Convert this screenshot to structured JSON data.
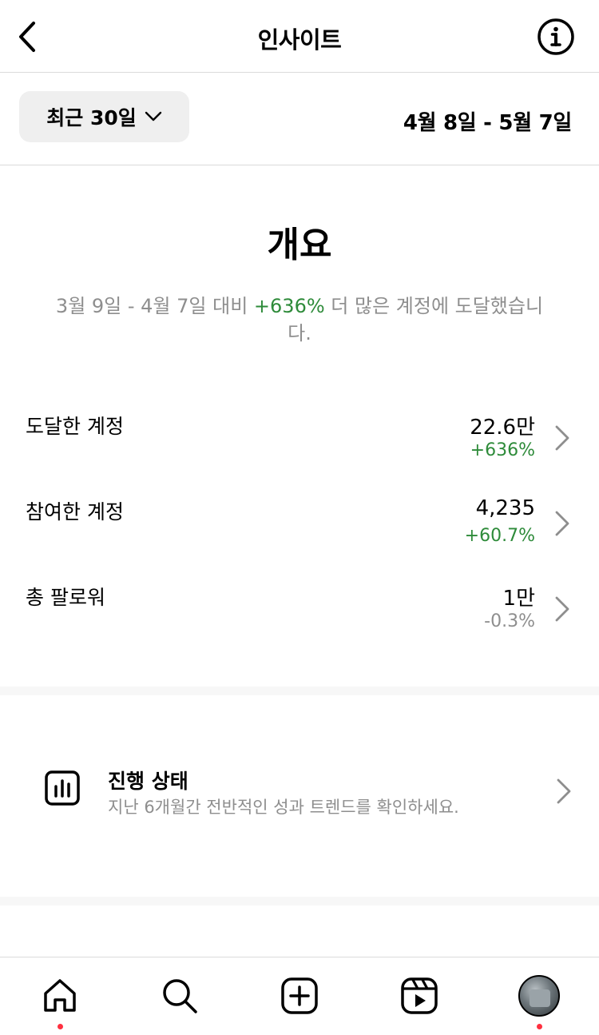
{
  "header": {
    "title": "인사이트",
    "back_icon": "chevron-left-icon",
    "info_icon": "info-icon"
  },
  "filter": {
    "period_label": "최근 30일",
    "date_range": "4월 8일 - 5월 7일"
  },
  "overview": {
    "title": "개요",
    "desc_prefix": "3월 9일 - 4월 7일 대비 ",
    "desc_pct": "+636%",
    "desc_suffix": " 더 많은 계정에 도달했습니다."
  },
  "metrics": [
    {
      "label": "도달한 계정",
      "value": "22.6만",
      "change": "+636%",
      "trend": "up"
    },
    {
      "label": "참여한 계정",
      "value": "4,235",
      "change": "+60.7%",
      "trend": "up"
    },
    {
      "label": "총 팔로워",
      "value": "1만",
      "change": "-0.3%",
      "trend": "down"
    }
  ],
  "progress": {
    "title": "진행 상태",
    "subtitle": "지난 6개월간 전반적인 성과 트렌드를 확인하세요.",
    "icon": "bar-chart-icon"
  },
  "tabbar": {
    "items": [
      "home-icon",
      "search-icon",
      "create-icon",
      "reels-icon",
      "profile-avatar"
    ]
  },
  "colors": {
    "positive": "#2e8b3a",
    "muted": "#8e8e8e",
    "notification_dot": "#ff3040",
    "divider": "#dbdbdb",
    "chip_bg": "#efefef"
  }
}
